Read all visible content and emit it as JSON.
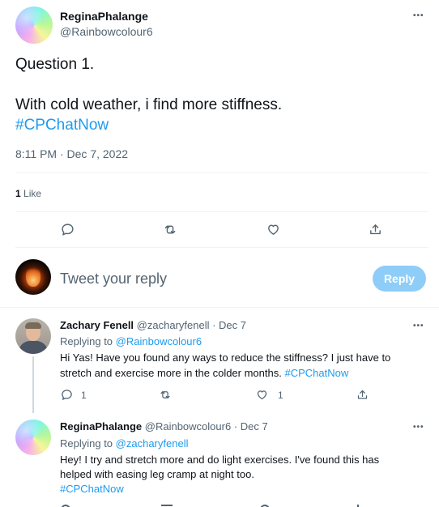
{
  "main_tweet": {
    "author_name": "ReginaPhalange",
    "author_handle": "@Rainbowcolour6",
    "line1": "Question 1.",
    "line2": "With cold weather, i find more stiffness.",
    "hashtag": "#CPChatNow",
    "timestamp": "8:11 PM · Dec 7, 2022",
    "likes_count": "1",
    "likes_label": "Like"
  },
  "reply_box": {
    "placeholder": "Tweet your reply",
    "button_label": "Reply"
  },
  "replies": [
    {
      "author_name": "Zachary Fenell",
      "author_handle": "@zacharyfenell",
      "date": "· Dec 7",
      "replying_to_label": "Replying to",
      "replying_to_handle": "@Rainbowcolour6",
      "text_line1": "Hi Yas! Have you found any ways to reduce the stiffness? I just have to",
      "text_line2": "stretch and exercise more in the colder months.",
      "hashtag": "#CPChatNow",
      "reply_count": "1",
      "like_count": "1"
    },
    {
      "author_name": "ReginaPhalange",
      "author_handle": "@Rainbowcolour6",
      "date": "· Dec 7",
      "replying_to_label": "Replying to",
      "replying_to_handle": "@zacharyfenell",
      "text_line1": "Hey! I try and stretch more and do light exercises. I've found this has",
      "text_line2": "helped with easing leg cramp at night too.",
      "hashtag": "#CPChatNow"
    }
  ],
  "more_label": "•••",
  "colors": {
    "accent": "#1d9bf0",
    "reply_button_disabled": "#8ecdf8",
    "text_primary": "#0f1419",
    "text_secondary": "#536471",
    "divider": "#eff3f4"
  }
}
